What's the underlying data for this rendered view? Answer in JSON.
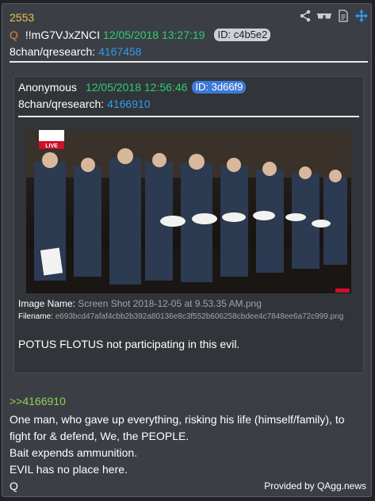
{
  "post": {
    "number": "2553",
    "q_label": "Q",
    "tripcode": "!!mG7VJxZNCI",
    "timestamp": "12/05/2018 13:27:19",
    "id_badge": "ID: c4b5e2",
    "board": "8chan/qresearch:",
    "post_ref": "4167458"
  },
  "quoted": {
    "author": "Anonymous",
    "timestamp": "12/05/2018 12:56:46",
    "id_badge": "ID: 3d66f9",
    "board": "8chan/qresearch:",
    "post_ref": "4166910",
    "live_badge": "LIVE",
    "image_name_label": "Image Name:",
    "image_name": "Screen Shot 2018-12-05 at 9.53.35 AM.png",
    "filename_label": "Filename:",
    "filename": "e693bcd47afaf4cbb2b392a80136e8c3f552b606258cbdee4c7848ee6a72c999.png",
    "body": "POTUS FLOTUS not participating in this evil."
  },
  "reply": {
    "link": ">>4166910",
    "lines": [
      "One man, who gave up everything, risking his life (himself/family), to fight for & defend, We, the PEOPLE.",
      "Bait expends ammunition.",
      "EVIL has no place here.",
      "Q"
    ]
  },
  "footer": {
    "provided_by": "Provided by QAgg.news"
  },
  "colors": {
    "background": "#1f2328",
    "card": "#3b3f45",
    "number": "#e8c24a",
    "date": "#2ecc71",
    "link": "#2f9bf0",
    "reply_link": "#8fd14f",
    "move_icon": "#2f9bf0"
  },
  "icons": [
    "share-icon",
    "glasses-icon",
    "document-icon",
    "move-icon"
  ]
}
